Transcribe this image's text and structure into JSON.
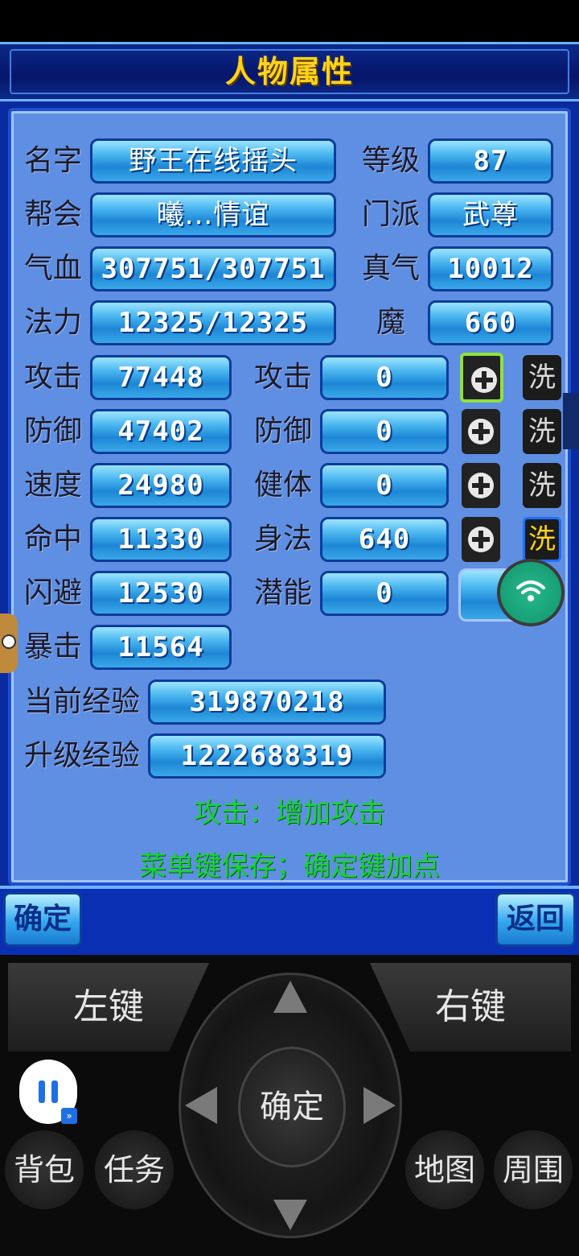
{
  "title": "人物属性",
  "rows": [
    {
      "label": "名字",
      "value": "野王在线摇头",
      "label2": "等级",
      "value2": "87"
    },
    {
      "label": "帮会",
      "value": "曦...情谊",
      "label2": "门派",
      "value2": "武尊"
    },
    {
      "label": "气血",
      "value": "307751/307751",
      "label2": "真气",
      "value2": "10012"
    },
    {
      "label": "法力",
      "value": "12325/12325",
      "label2": "魔",
      "value2": "660"
    }
  ],
  "stats": [
    {
      "label": "攻击",
      "value": "77448",
      "label2": "攻击",
      "value2": "0"
    },
    {
      "label": "防御",
      "value": "47402",
      "label2": "防御",
      "value2": "0"
    },
    {
      "label": "速度",
      "value": "24980",
      "label2": "健体",
      "value2": "0"
    },
    {
      "label": "命中",
      "value": "11330",
      "label2": "身法",
      "value2": "640"
    },
    {
      "label": "闪避",
      "value": "12530",
      "label2": "潜能",
      "value2": "0"
    },
    {
      "label": "暴击",
      "value": "11564"
    }
  ],
  "wash_label": "洗",
  "exp": {
    "current_label": "当前经验",
    "current_value": "319870218",
    "next_label": "升级经验",
    "next_value": "1222688319"
  },
  "hints": {
    "line1": "攻击：增加攻击",
    "line2": "菜单键保存；确定键加点"
  },
  "buttons": {
    "confirm": "确定",
    "back": "返回"
  },
  "controller": {
    "left_key": "左键",
    "right_key": "右键",
    "center": "确定",
    "bag": "背包",
    "task": "任务",
    "map": "地图",
    "around": "周围"
  },
  "colors": {
    "title": "#ffd21a",
    "hint": "#19d23a",
    "panel": "#5f8fe2"
  }
}
